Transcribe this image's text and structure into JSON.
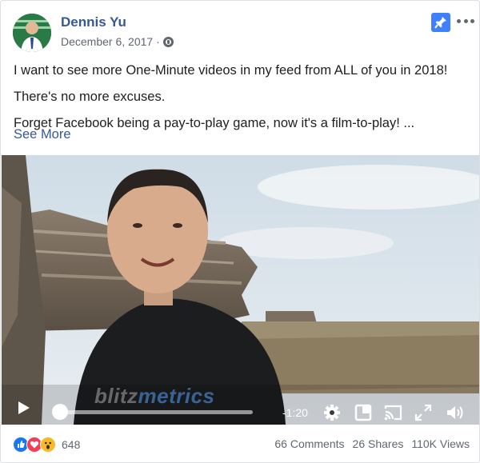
{
  "post": {
    "author": "Dennis Yu",
    "date": "December 6, 2017 ·",
    "paragraphs": [
      "I want to see more One-Minute videos in my feed from ALL of you in 2018!",
      "There's no more excuses.",
      "Forget Facebook being a pay-to-play game, now it's a film-to-play! ..."
    ],
    "see_more": "See More"
  },
  "video": {
    "watermark_a": "blitz",
    "watermark_b": "metrics",
    "time_remaining": "-1:20",
    "progress": 0.0
  },
  "footer": {
    "reaction_count": "648",
    "comments": "66 Comments",
    "shares": "26 Shares",
    "views": "110K Views"
  },
  "colors": {
    "link": "#365899",
    "accent": "#4080ff"
  },
  "icons": [
    "globe-icon",
    "pin-icon",
    "more-icon",
    "play-icon",
    "gear-icon",
    "miniplayer-icon",
    "cast-icon",
    "fullscreen-icon",
    "volume-icon",
    "like-reaction-icon",
    "love-reaction-icon",
    "wow-reaction-icon"
  ]
}
